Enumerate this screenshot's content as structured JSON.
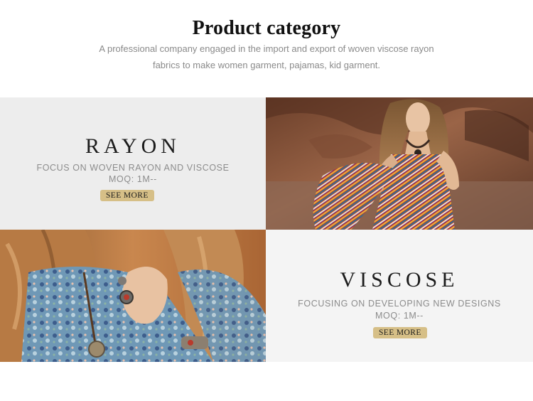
{
  "header": {
    "title": "Product category",
    "subtitle_line1": "A professional company engaged in the import and export of woven viscose rayon",
    "subtitle_line2": "fabrics to make women garment, pajamas, kid garment."
  },
  "categories": [
    {
      "name": "RAYON",
      "description": "FOCUS ON WOVEN RAYON AND VISCOSE",
      "moq": "MOQ: 1M--",
      "button_label": "SEE MORE"
    },
    {
      "name": "VISCOSE",
      "description": "FOCUSING ON DEVELOPING NEW DESIGNS",
      "moq": "MOQ: 1M--",
      "button_label": "SEE MORE"
    }
  ],
  "colors": {
    "button_bg": "#d6bf87",
    "rayon_panel_bg": "#ededed",
    "viscose_panel_bg": "#f4f4f4",
    "title_text": "#111111",
    "muted_text": "#8c8c8c"
  }
}
